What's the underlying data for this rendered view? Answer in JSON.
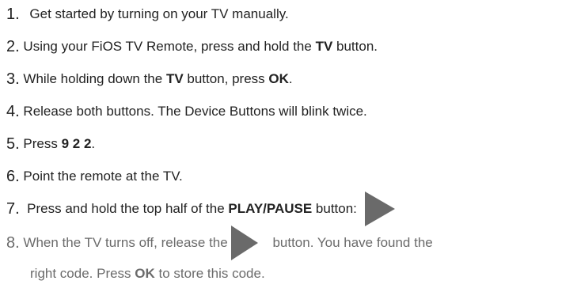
{
  "steps": [
    {
      "num": "1.",
      "text": "Get started by turning on your TV manually."
    },
    {
      "num": "2.",
      "pre": "Using your FiOS TV Remote, press and hold the ",
      "bold": "TV",
      "post": " button."
    },
    {
      "num": "3.",
      "pre": "While holding down the ",
      "bold": "TV",
      "mid": " button, press ",
      "bold2": "OK",
      "post": "."
    },
    {
      "num": "4.",
      "text": "Release both buttons. The Device Buttons will blink twice."
    },
    {
      "num": "5.",
      "pre": "Press ",
      "bold": "9 2 2",
      "post": "."
    },
    {
      "num": "6.",
      "text": "Point the remote at the TV."
    },
    {
      "num": "7.",
      "pre": "Press and hold the top half of the ",
      "bold": "PLAY/PAUSE",
      "post": " button:"
    },
    {
      "num": "8.",
      "pre": "When the TV turns off, release the",
      "post": " button. You have found the",
      "line2_pre": "right code. Press ",
      "line2_bold": "OK",
      "line2_post": " to store this code."
    }
  ],
  "icons": {
    "play": "play-icon"
  }
}
